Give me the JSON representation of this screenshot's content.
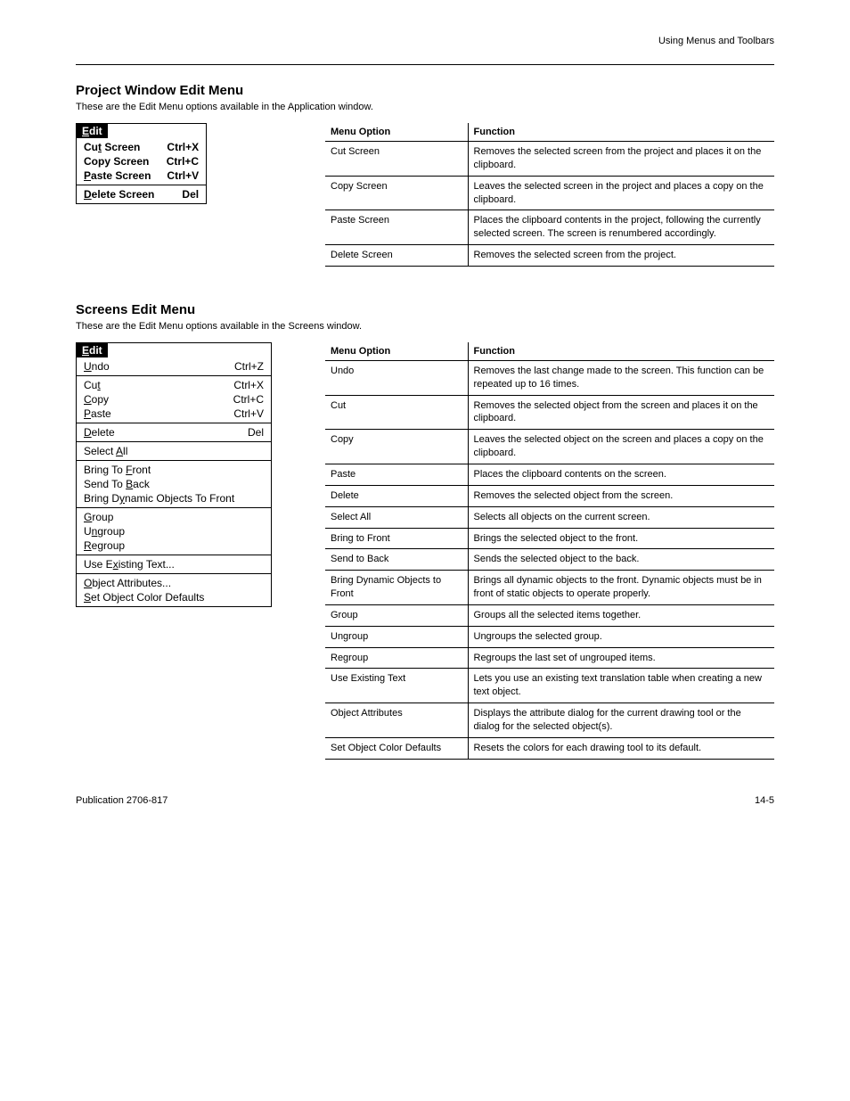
{
  "header": {
    "left": "",
    "right": "Using Menus and Toolbars"
  },
  "section1": {
    "title": "Project Window Edit Menu",
    "subtitle": "These are the Edit Menu options available in the Application window.",
    "menu_label": "Edit",
    "menu_items": [
      {
        "label": "Cut Screen",
        "ul": "t",
        "shortcut": "Ctrl+X",
        "bold": true
      },
      {
        "label": "Copy Screen",
        "ul": "",
        "shortcut": "Ctrl+C",
        "bold": true
      },
      {
        "label": "Paste Screen",
        "ul": "P",
        "shortcut": "Ctrl+V",
        "bold": true
      },
      {
        "sep": true
      },
      {
        "label": "Delete Screen",
        "ul": "D",
        "shortcut": "Del",
        "bold": true
      }
    ],
    "table_head": [
      "Menu Option",
      "Function"
    ],
    "table": [
      [
        "Cut Screen",
        "Removes the selected screen from the project and places it on the clipboard."
      ],
      [
        "Copy Screen",
        "Leaves the selected screen in the project and places a copy on the clipboard."
      ],
      [
        "Paste Screen",
        "Places the clipboard contents in the project, following the currently selected screen. The screen is renumbered accordingly."
      ],
      [
        "Delete Screen",
        "Removes the selected screen from the project."
      ]
    ]
  },
  "section2": {
    "title": "Screens Edit Menu",
    "subtitle": "These are the Edit Menu options available in the Screens window.",
    "menu_label": "Edit",
    "menu_items": [
      {
        "label": "Undo",
        "ul": "U",
        "shortcut": "Ctrl+Z"
      },
      {
        "sep": true
      },
      {
        "label": "Cut",
        "ul": "t",
        "shortcut": "Ctrl+X"
      },
      {
        "label": "Copy",
        "ul": "C",
        "shortcut": "Ctrl+C"
      },
      {
        "label": "Paste",
        "ul": "P",
        "shortcut": "Ctrl+V"
      },
      {
        "sep": true
      },
      {
        "label": "Delete",
        "ul": "D",
        "shortcut": "Del"
      },
      {
        "sep": true
      },
      {
        "label": "Select All",
        "ul": "A",
        "shortcut": ""
      },
      {
        "sep": true
      },
      {
        "label": "Bring To Front",
        "ul": "F",
        "shortcut": ""
      },
      {
        "label": "Send To Back",
        "ul": "B",
        "shortcut": ""
      },
      {
        "label": "Bring Dynamic Objects To Front",
        "ul": "y",
        "shortcut": ""
      },
      {
        "sep": true
      },
      {
        "label": "Group",
        "ul": "G",
        "shortcut": ""
      },
      {
        "label": "Ungroup",
        "ul": "n",
        "shortcut": ""
      },
      {
        "label": "Regroup",
        "ul": "R",
        "shortcut": ""
      },
      {
        "sep": true
      },
      {
        "label": "Use Existing Text...",
        "ul": "x",
        "shortcut": ""
      },
      {
        "sep": true
      },
      {
        "label": "Object Attributes...",
        "ul": "O",
        "shortcut": ""
      },
      {
        "label": "Set Object Color Defaults",
        "ul": "S",
        "shortcut": ""
      }
    ],
    "table_head": [
      "Menu Option",
      "Function"
    ],
    "table": [
      [
        "Undo",
        "Removes the last change made to the screen. This function can be repeated up to 16 times."
      ],
      [
        "Cut",
        "Removes the selected object from the screen and places it on the clipboard."
      ],
      [
        "Copy",
        "Leaves the selected object on the screen and places a copy on the clipboard."
      ],
      [
        "Paste",
        "Places the clipboard contents on the screen."
      ],
      [
        "Delete",
        "Removes the selected object from the screen."
      ],
      [
        "Select All",
        "Selects all objects on the current screen."
      ],
      [
        "Bring to Front",
        "Brings the selected object to the front."
      ],
      [
        "Send to Back",
        "Sends the selected object to the back."
      ],
      [
        "Bring Dynamic Objects to Front",
        "Brings all dynamic objects to the front. Dynamic objects must be in front of static objects to operate properly."
      ],
      [
        "Group",
        "Groups all the selected items together."
      ],
      [
        "Ungroup",
        "Ungroups the selected group."
      ],
      [
        "Regroup",
        "Regroups the last set of ungrouped items."
      ],
      [
        "Use Existing Text",
        "Lets you use an existing text translation table when creating a new text object."
      ],
      [
        "Object Attributes",
        "Displays the attribute dialog for the current drawing tool or the dialog for the selected object(s)."
      ],
      [
        "Set Object Color Defaults",
        "Resets the colors for each drawing tool to its default."
      ]
    ]
  },
  "footer": {
    "left": "Publication 2706-817",
    "right": "14-5"
  }
}
